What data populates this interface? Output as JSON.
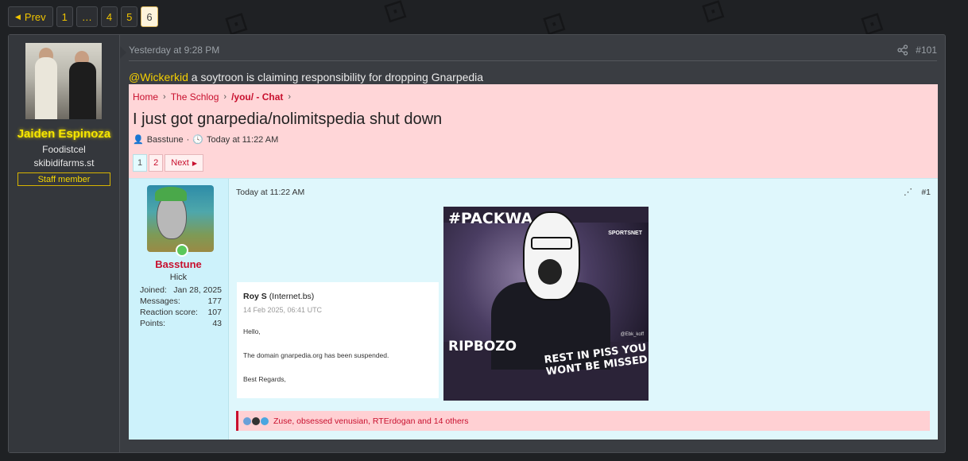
{
  "pagination": {
    "prev_label": "Prev",
    "pages": [
      "1",
      "…",
      "4",
      "5",
      "6"
    ],
    "current_page": "6"
  },
  "post": {
    "author": {
      "name": "Jaiden Espinoza",
      "title": "Foodistcel",
      "site": "skibidifarms.st",
      "banner": "Staff member"
    },
    "date": "Yesterday at 9:28 PM",
    "number": "#101",
    "mention": "@Wickerkid",
    "message": " a soytroon is claiming responsibility for dropping Gnarpedia"
  },
  "embed": {
    "breadcrumb": [
      "Home",
      "The Schlog",
      "/you/ - Chat"
    ],
    "thread_title": "I just got gnarpedia/nolimitspedia shut down",
    "thread_author": "Basstune",
    "thread_date": "Today at 11:22 AM",
    "pages": [
      "1",
      "2"
    ],
    "next_label": "Next",
    "post": {
      "username": "Basstune",
      "user_title": "Hick",
      "stats": [
        {
          "label": "Joined:",
          "value": "Jan 28, 2025"
        },
        {
          "label": "Messages:",
          "value": "177"
        },
        {
          "label": "Reaction score:",
          "value": "107"
        },
        {
          "label": "Points:",
          "value": "43"
        }
      ],
      "date": "Today at 11:22 AM",
      "number": "#1",
      "email": {
        "from_name": "Roy S",
        "from_org": "(Internet.bs)",
        "date": "14 Feb 2025, 06:41 UTC",
        "line1": "Hello,",
        "line2": "The domain gnarpedia.org has been suspended.",
        "line3": "Best Regards,"
      },
      "meme": {
        "top_text": "#PACKWA",
        "bottom_left": "RIPBOZO",
        "bottom_right": "REST IN PISS YOU WONT BE MISSED",
        "logo": "SPORTSNET",
        "watermark": "@Ebk_koff"
      },
      "reactions": "Zuse, obsessed venusian, RTErdogan and 14 others"
    }
  }
}
